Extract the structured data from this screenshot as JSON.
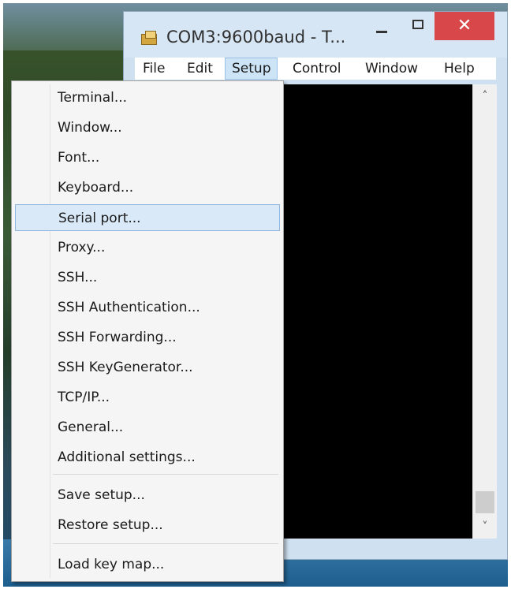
{
  "window": {
    "title": "COM3:9600baud - T...",
    "close_glyph": "✕",
    "icon": "teraterm-app-icon"
  },
  "menubar": {
    "items": [
      {
        "label": "File"
      },
      {
        "label": "Edit"
      },
      {
        "label": "Setup",
        "active": true
      },
      {
        "label": "Control"
      },
      {
        "label": "Window"
      },
      {
        "label": "Help"
      }
    ]
  },
  "setup_menu": {
    "group1": [
      {
        "label": "Terminal..."
      },
      {
        "label": "Window..."
      },
      {
        "label": "Font..."
      },
      {
        "label": "Keyboard..."
      },
      {
        "label": "Serial port...",
        "highlighted": true
      },
      {
        "label": "Proxy..."
      },
      {
        "label": "SSH..."
      },
      {
        "label": "SSH Authentication..."
      },
      {
        "label": "SSH Forwarding..."
      },
      {
        "label": "SSH KeyGenerator..."
      },
      {
        "label": "TCP/IP..."
      },
      {
        "label": "General..."
      },
      {
        "label": "Additional settings..."
      }
    ],
    "group2": [
      {
        "label": "Save setup..."
      },
      {
        "label": "Restore setup..."
      }
    ],
    "group3": [
      {
        "label": "Load key map..."
      }
    ]
  },
  "scrollbar": {
    "up_glyph": "˄",
    "down_glyph": "˅"
  },
  "colors": {
    "close_button": "#d8474a",
    "terminal_bg": "#000000",
    "highlight": "#d9e9f8"
  }
}
